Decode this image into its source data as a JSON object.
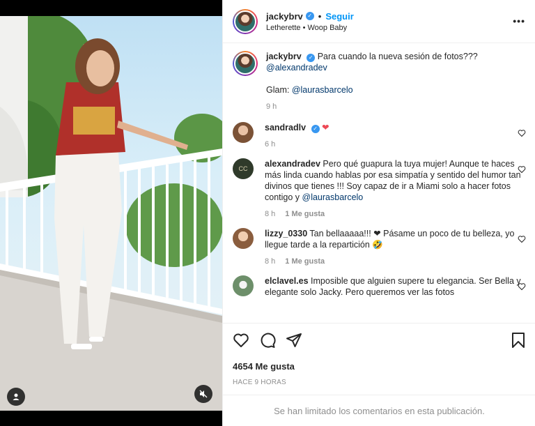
{
  "header": {
    "username": "jackybrv",
    "separator": "•",
    "follow_label": "Seguir",
    "audio": "Letherette • Woop Baby",
    "more_label": "•••"
  },
  "caption": {
    "username": "jackybrv",
    "text": "Para cuando la nueva sesión de fotos???",
    "mention": "@alexandradev",
    "glam_prefix": "Glam: ",
    "glam_mention": "@laurasbarcelo",
    "time": "9 h"
  },
  "comments": [
    {
      "username": "sandradlv",
      "text": "❤",
      "time": "6 h",
      "likes": ""
    },
    {
      "username": "alexandradev",
      "text": "Pero qué guapura la tuya mujer! Aunque te haces más linda cuando hablas por esa simpatía y sentido del humor tan divinos que tienes !!! Soy capaz de ir a Miami solo a hacer fotos contigo y ",
      "mention": "@laurasbarcelo",
      "time": "8 h",
      "likes": "1 Me gusta"
    },
    {
      "username": "lizzy_0330",
      "text": "Tan bellaaaaa!!! ❤ Pásame un poco de tu belleza, yo llegue tarde a la repartición 🤣",
      "time": "8 h",
      "likes": "1 Me gusta"
    },
    {
      "username": "elclavel.es",
      "text": "Imposible que alguien supere tu elegancia. Ser Bella y elegante solo Jacky. Pero queremos ver las fotos",
      "time": "",
      "likes": ""
    }
  ],
  "footer": {
    "likes_count": "4654 Me gusta",
    "posted": "HACE 9 HORAS",
    "limited_notice": "Se han limitado los comentarios en esta publicación."
  },
  "colors": {
    "accent": "#0095f6",
    "verified": "#3897f0",
    "heart": "#ed4956",
    "muted": "#8e8e8e"
  },
  "icons": [
    "user-icon",
    "mute-icon",
    "verified-icon",
    "more-icon",
    "heart-icon",
    "comment-icon",
    "share-icon",
    "save-icon"
  ]
}
